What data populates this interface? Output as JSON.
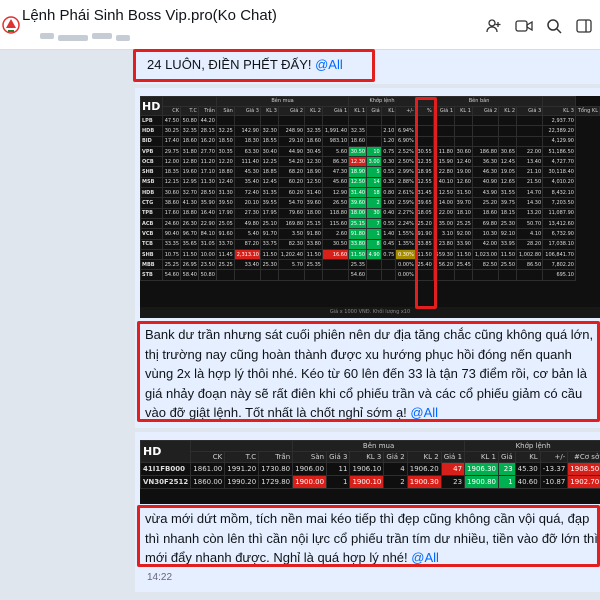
{
  "header": {
    "title": "Lệnh Phái Sinh Boss Vip.pro(Ko Chat)",
    "icons": [
      "add-member-icon",
      "video-call-icon",
      "search-icon",
      "panel-toggle-icon"
    ]
  },
  "messages": [
    {
      "text": "24 LUÔN, ĐIỀN PHẾT ĐẤY! ",
      "mention": "@All"
    },
    {
      "text": "Bank dư trần nhưng sát cuối phiên nên dư địa tăng chắc cũng không quá lớn, thị trường nay cũng hoàn thành được xu hướng phục hồi đóng nến quanh vùng 2x là hợp lý thôi nhé. Kéo từ 60 lên đến 33 là tận 73 điểm rồi, cơ bản là giá nhảy đoạn này sẽ rất điên khi cổ phiếu trần và các cổ phiếu giảm có cầu vào đỡ giật lệnh. Tốt nhất là chốt nghỉ sớm ạ! ",
      "mention": "@All"
    },
    {
      "text": "vừa mới dứt mồm, tích nền mai kéo tiếp thì đẹp cũng không cần vội quá, đạp thì nhanh còn lên thì cần nội lực cổ phiếu trần tím dư nhiều, tiền vào đỡ lớn thì mới đẩy nhanh được. Nghỉ là quá hợp lý nhé! ",
      "mention": "@All",
      "time": "14:22"
    }
  ],
  "board1": {
    "hd": "HD",
    "headers": [
      "CK",
      "T.C",
      "Trần",
      "Sàn",
      "Giá 3",
      "KL 3",
      "Giá 2",
      "KL 2",
      "Giá 1",
      "KL 1",
      "Giá",
      "KL",
      "+/-",
      "%",
      "Giá 1",
      "KL 1",
      "Giá 2",
      "KL 2",
      "Giá 3",
      "KL 3",
      "Tổng KL"
    ],
    "group_headers": [
      "Bên mua",
      "Khớp lệnh",
      "Bên bán"
    ],
    "rows": [
      {
        "c": [
          "LPB",
          "47.50",
          "50.80",
          "44.20",
          "",
          "",
          "",
          "",
          "",
          "",
          "",
          "",
          "",
          "",
          "",
          "",
          "",
          "",
          "",
          "",
          "2,937.70"
        ],
        "cls": "pink"
      },
      {
        "c": [
          "HDB",
          "30.25",
          "32.35",
          "28.15",
          "32.25",
          "142.90",
          "32.30",
          "248.90",
          "32.35",
          "1,991.40",
          "32.35",
          "",
          "2.10",
          "6.94%",
          "",
          "",
          "",
          "",
          "",
          "",
          "22,389.20"
        ],
        "cls": "pink"
      },
      {
        "c": [
          "BID",
          "17.40",
          "18.60",
          "16.20",
          "18.50",
          "18.30",
          "18.55",
          "29.10",
          "18.60",
          "983.10",
          "18.60",
          "",
          "1.20",
          "6.90%",
          "",
          "",
          "",
          "",
          "",
          "",
          "4,129.90"
        ],
        "cls": "pink"
      },
      {
        "c": [
          "VPB",
          "29.75",
          "31.80",
          "27.70",
          "30.35",
          "63.30",
          "30.40",
          "44.90",
          "30.45",
          "5.60",
          "30.50",
          "10",
          "0.75",
          "2.52%",
          "30.55",
          "11.80",
          "30.60",
          "186.80",
          "30.65",
          "22.00",
          "51,186.50"
        ],
        "cls": "green"
      },
      {
        "c": [
          "OCB",
          "12.00",
          "12.80",
          "11.20",
          "12.20",
          "111.40",
          "12.25",
          "54.20",
          "12.30",
          "86.30",
          "12.30",
          "3.00",
          "0.30",
          "2.50%",
          "12.35",
          "15.90",
          "12.40",
          "36.30",
          "12.45",
          "13.40",
          "4,727.70"
        ],
        "cls": "green"
      },
      {
        "c": [
          "SHB",
          "18.35",
          "19.60",
          "17.10",
          "18.80",
          "45.30",
          "18.85",
          "68.20",
          "18.90",
          "47.30",
          "18.90",
          "5",
          "0.55",
          "2.99%",
          "18.95",
          "22.80",
          "19.00",
          "46.30",
          "19.05",
          "21.10",
          "30,118.40"
        ],
        "cls": "green"
      },
      {
        "c": [
          "MSB",
          "12.15",
          "12.95",
          "11.30",
          "12.40",
          "35.40",
          "12.45",
          "60.20",
          "12.50",
          "45.60",
          "12.50",
          "14",
          "0.35",
          "2.88%",
          "12.55",
          "40.10",
          "12.60",
          "40.90",
          "12.65",
          "21.50",
          "4,010.20"
        ],
        "cls": "green"
      },
      {
        "c": [
          "HDB",
          "30.60",
          "32.70",
          "28.50",
          "31.30",
          "72.40",
          "31.35",
          "60.20",
          "31.40",
          "12.90",
          "31.40",
          "18",
          "0.80",
          "2.61%",
          "31.45",
          "12.50",
          "31.50",
          "43.90",
          "31.55",
          "14.70",
          "8,432.10"
        ],
        "cls": "green"
      },
      {
        "c": [
          "CTG",
          "38.60",
          "41.30",
          "35.90",
          "39.50",
          "20.10",
          "39.55",
          "54.70",
          "39.60",
          "26.50",
          "39.60",
          "2",
          "1.00",
          "2.59%",
          "39.65",
          "14.00",
          "39.70",
          "25.20",
          "39.75",
          "14.30",
          "7,203.50"
        ],
        "cls": "green"
      },
      {
        "c": [
          "TPB",
          "17.60",
          "18.80",
          "16.40",
          "17.90",
          "27.30",
          "17.95",
          "79.60",
          "18.00",
          "118.80",
          "18.00",
          "30",
          "0.40",
          "2.27%",
          "18.05",
          "22.00",
          "18.10",
          "18.60",
          "18.15",
          "13.20",
          "11,087.90"
        ],
        "cls": "green"
      },
      {
        "c": [
          "ACB",
          "24.60",
          "26.30",
          "22.90",
          "25.05",
          "49.80",
          "25.10",
          "169.80",
          "25.15",
          "115.60",
          "25.15",
          "7",
          "0.55",
          "2.24%",
          "25.20",
          "35.00",
          "25.25",
          "69.80",
          "25.30",
          "50.70",
          "13,412.60"
        ],
        "cls": "green"
      },
      {
        "c": [
          "VCB",
          "90.40",
          "96.70",
          "84.10",
          "91.60",
          "5.40",
          "91.70",
          "3.50",
          "91.80",
          "2.60",
          "91.80",
          "1",
          "1.40",
          "1.55%",
          "91.90",
          "3.10",
          "92.00",
          "10.30",
          "92.10",
          "4.10",
          "6,732.90"
        ],
        "cls": "green"
      },
      {
        "c": [
          "TCB",
          "33.35",
          "35.65",
          "31.05",
          "33.70",
          "87.20",
          "33.75",
          "82.30",
          "33.80",
          "30.50",
          "33.80",
          "8",
          "0.45",
          "1.35%",
          "33.85",
          "23.80",
          "33.90",
          "42.00",
          "33.95",
          "28.20",
          "17,038.10"
        ],
        "cls": "green"
      },
      {
        "c": [
          "SHB",
          "10.75",
          "11.50",
          "10.00",
          "11.45",
          "2,313.10",
          "11.50",
          "1,202.40",
          "11.50",
          "16.60",
          "11.50",
          "4.90",
          "0.75",
          "0.30%",
          "11.50",
          "559.30",
          "11.50",
          "1,023.00",
          "11.50",
          "1,002.80",
          "106,841.70"
        ],
        "cls": "green"
      },
      {
        "c": [
          "MBB",
          "25.25",
          "26.95",
          "23.50",
          "25.25",
          "33.40",
          "25.30",
          "5.70",
          "25.35",
          "",
          "25.35",
          "",
          "",
          "0.00%",
          "25.40",
          "56.20",
          "25.45",
          "82.50",
          "25.50",
          "86.50",
          "7,802.20"
        ],
        "cls": "yellow"
      },
      {
        "c": [
          "STB",
          "54.60",
          "58.40",
          "50.80",
          "",
          "",
          "",
          "",
          "",
          "",
          "54.60",
          "",
          "",
          "0.00%",
          "",
          "",
          "",
          "",
          "",
          "",
          "695.10"
        ],
        "cls": "yellow"
      }
    ],
    "footer": "Giá x 1000 VNĐ. Khối lượng x10"
  },
  "board2": {
    "hd": "HD",
    "headers": [
      "CK",
      "T.C",
      "Trần",
      "Sàn",
      "Giá 3",
      "KL 3",
      "Giá 2",
      "KL 2",
      "Giá 1",
      "KL 1",
      "Giá",
      "KL",
      "+/-",
      "#Cơ sở",
      "Giá 1"
    ],
    "group_headers": [
      "Bên mua",
      "Khớp lệnh"
    ],
    "rows": [
      {
        "c": [
          "41I1FB000",
          "1861.00",
          "1991.20",
          "1730.80",
          "1906.00",
          "11",
          "1906.10",
          "4",
          "1906.20",
          "47",
          "1906.30",
          "23",
          "45.30",
          "-13.37",
          "1908.50"
        ]
      },
      {
        "c": [
          "VN30F2512",
          "1860.00",
          "1990.20",
          "1729.80",
          "1900.00",
          "1",
          "1900.10",
          "2",
          "1900.30",
          "23",
          "1900.80",
          "1",
          "40.60",
          "-10.87",
          "1902.70"
        ]
      }
    ]
  }
}
